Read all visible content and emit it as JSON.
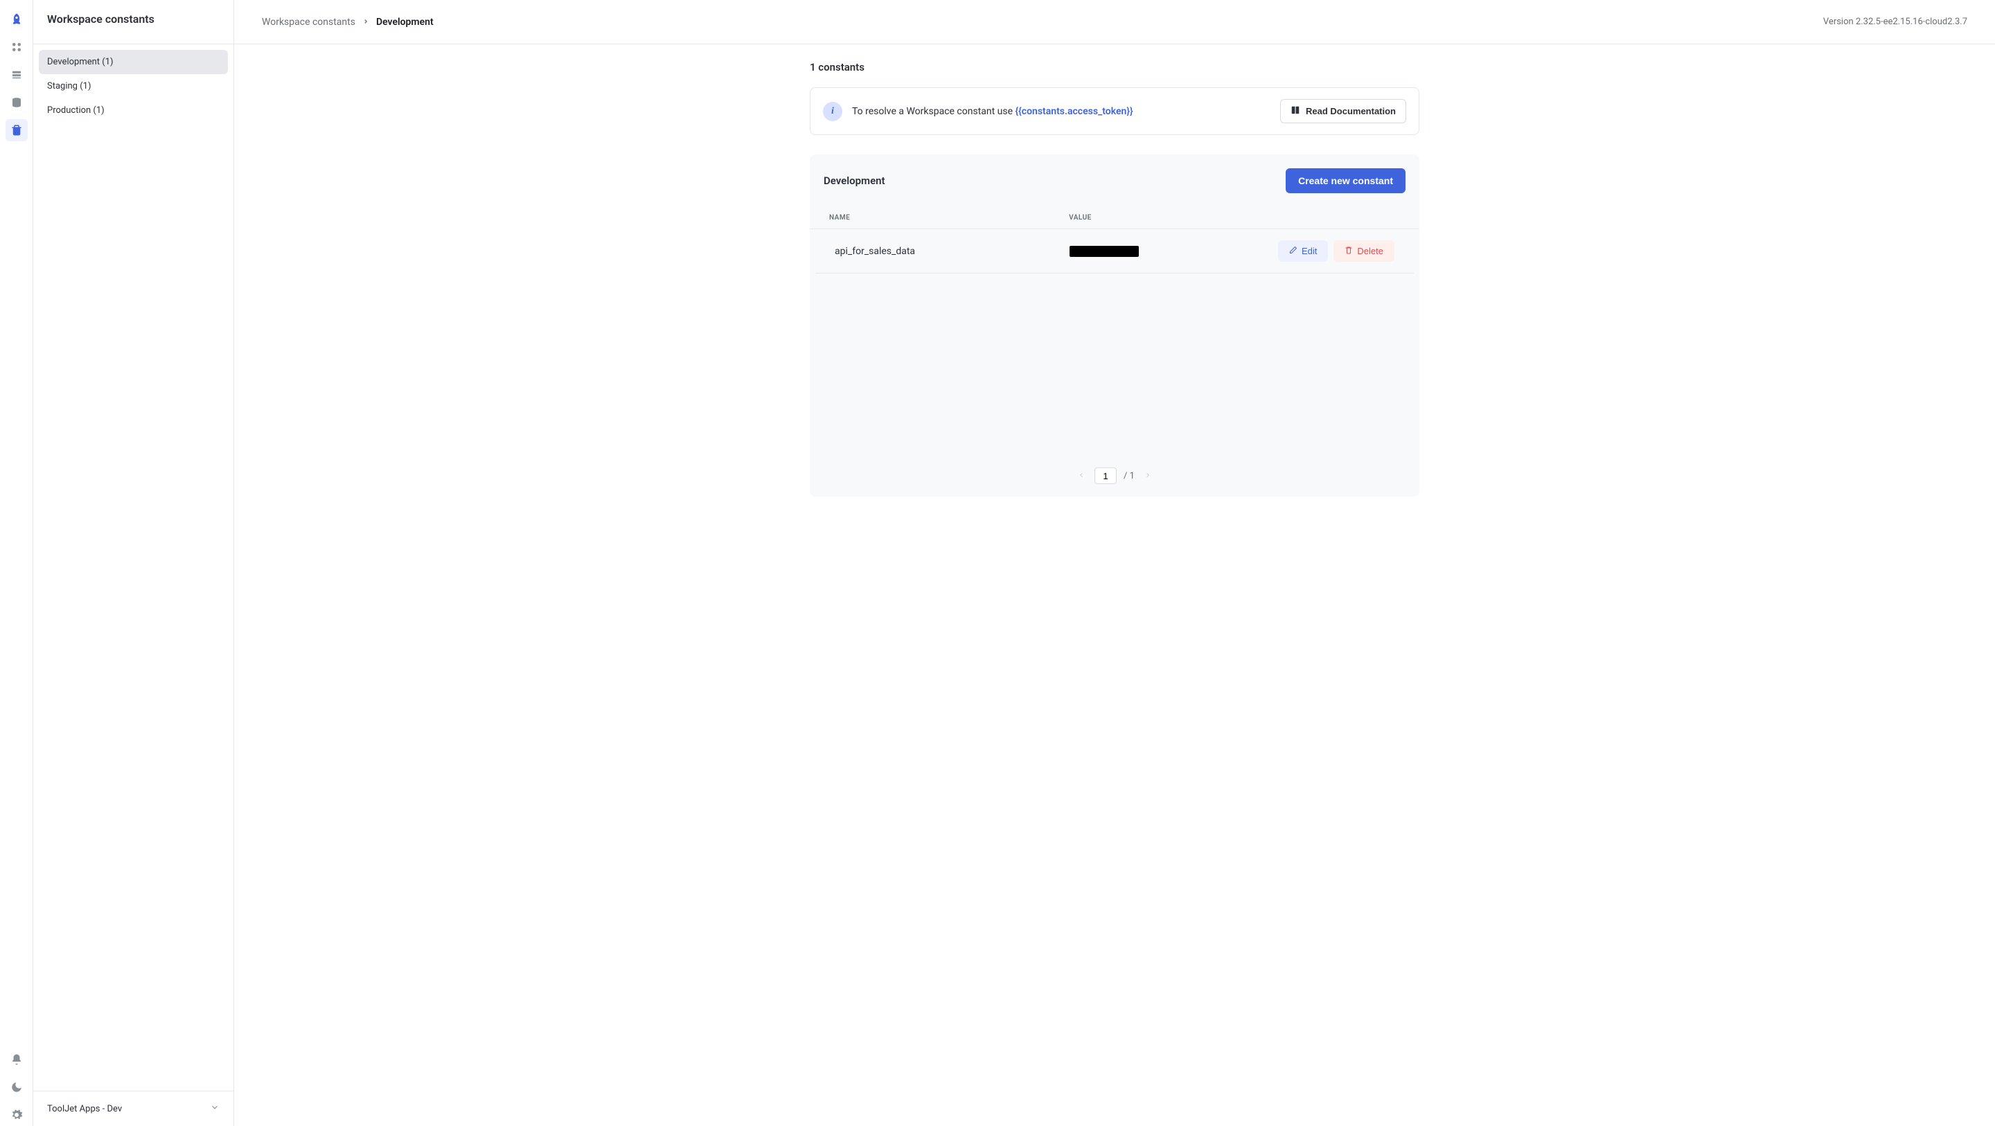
{
  "header": {
    "title": "Workspace constants",
    "breadcrumb_root": "Workspace constants",
    "breadcrumb_current": "Development",
    "version": "Version 2.32.5-ee2.15.16-cloud2.3.7"
  },
  "sidebar": {
    "environments": [
      {
        "label": "Development (1)",
        "active": true
      },
      {
        "label": "Staging (1)",
        "active": false
      },
      {
        "label": "Production (1)",
        "active": false
      }
    ],
    "workspace_selector": "ToolJet Apps - Dev"
  },
  "main": {
    "count_text": "1 constants",
    "info": {
      "prefix": "To resolve a Workspace constant use ",
      "token": "{{constants.access_token}}",
      "doc_button": "Read Documentation"
    },
    "card": {
      "title": "Development",
      "create_button": "Create new constant",
      "columns": {
        "name": "NAME",
        "value": "VALUE"
      },
      "rows": [
        {
          "name": "api_for_sales_data",
          "value_redacted": true
        }
      ],
      "edit_label": "Edit",
      "delete_label": "Delete"
    },
    "pagination": {
      "current": "1",
      "total": "1"
    }
  }
}
